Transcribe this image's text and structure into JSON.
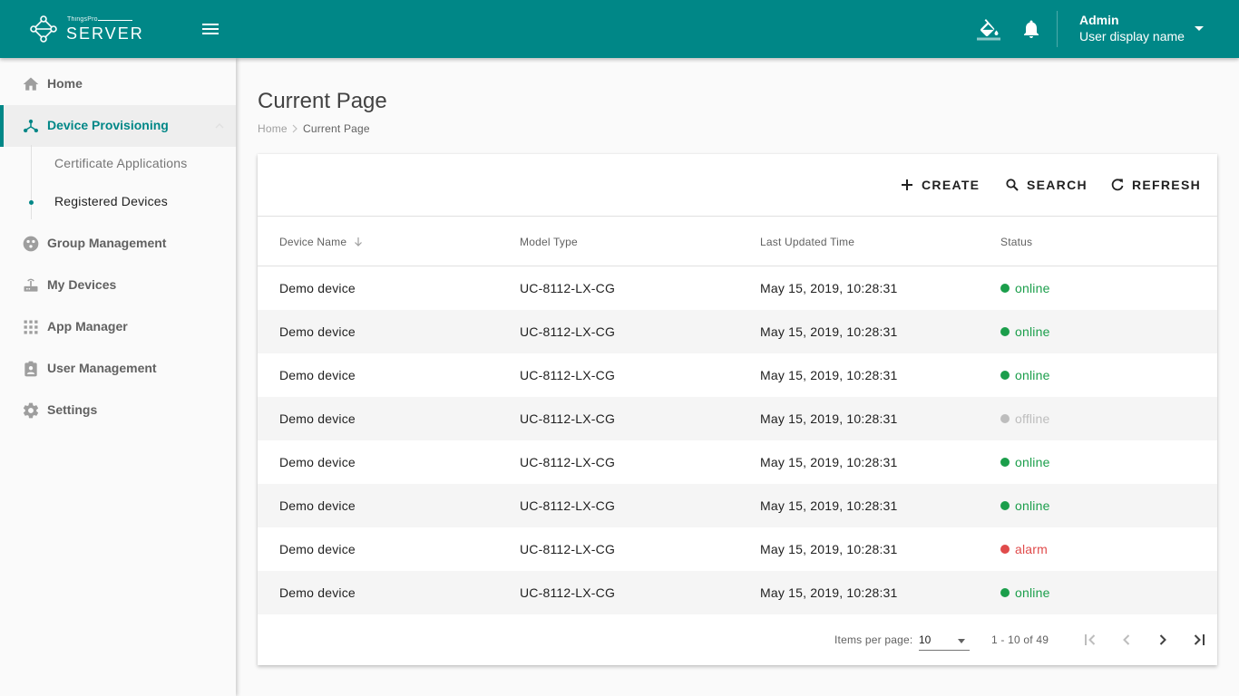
{
  "app": {
    "logo_small": "ThingsPro",
    "logo_big": "SERVER",
    "brand_color": "#008787"
  },
  "header": {
    "menu_icon": "hamburger-menu-icon",
    "theme_icon": "paint-bucket-icon",
    "notification_icon": "bell-icon",
    "user": {
      "name": "Admin",
      "display": "User display name"
    }
  },
  "sidebar": {
    "items": [
      {
        "label": "Home",
        "icon": "home-icon"
      },
      {
        "label": "Device Provisioning",
        "icon": "hub-icon",
        "active": true
      },
      {
        "label": "Group Management",
        "icon": "group-icon"
      },
      {
        "label": "My Devices",
        "icon": "router-icon"
      },
      {
        "label": "App Manager",
        "icon": "apps-grid-icon"
      },
      {
        "label": "User Management",
        "icon": "badge-icon"
      },
      {
        "label": "Settings",
        "icon": "gear-icon"
      }
    ],
    "sub_items": [
      {
        "label": "Certificate Applications"
      },
      {
        "label": "Registered Devices",
        "selected": true
      }
    ]
  },
  "page": {
    "title": "Current Page",
    "breadcrumb": {
      "home": "Home",
      "current": "Current Page"
    }
  },
  "toolbar": {
    "create": "CREATE",
    "search": "SEARCH",
    "refresh": "REFRESH"
  },
  "table": {
    "columns": [
      "Device Name",
      "Model Type",
      "Last Updated Time",
      "Status"
    ],
    "status_colors": {
      "online": "#1b9e4b",
      "offline": "#bdbdbd",
      "alarm": "#e04b4b"
    },
    "rows": [
      {
        "name": "Demo device",
        "model": "UC-8112-LX-CG",
        "time": "May 15, 2019, 10:28:31",
        "status": "online"
      },
      {
        "name": "Demo device",
        "model": "UC-8112-LX-CG",
        "time": "May 15, 2019, 10:28:31",
        "status": "online"
      },
      {
        "name": "Demo device",
        "model": "UC-8112-LX-CG",
        "time": "May 15, 2019, 10:28:31",
        "status": "online"
      },
      {
        "name": "Demo device",
        "model": "UC-8112-LX-CG",
        "time": "May 15, 2019, 10:28:31",
        "status": "offline"
      },
      {
        "name": "Demo device",
        "model": "UC-8112-LX-CG",
        "time": "May 15, 2019, 10:28:31",
        "status": "online"
      },
      {
        "name": "Demo device",
        "model": "UC-8112-LX-CG",
        "time": "May 15, 2019, 10:28:31",
        "status": "online"
      },
      {
        "name": "Demo device",
        "model": "UC-8112-LX-CG",
        "time": "May 15, 2019, 10:28:31",
        "status": "alarm"
      },
      {
        "name": "Demo device",
        "model": "UC-8112-LX-CG",
        "time": "May 15, 2019, 10:28:31",
        "status": "online"
      }
    ]
  },
  "paginator": {
    "items_per_page_label": "Items per page:",
    "items_per_page": "10",
    "range": "1 - 10 of 49"
  }
}
